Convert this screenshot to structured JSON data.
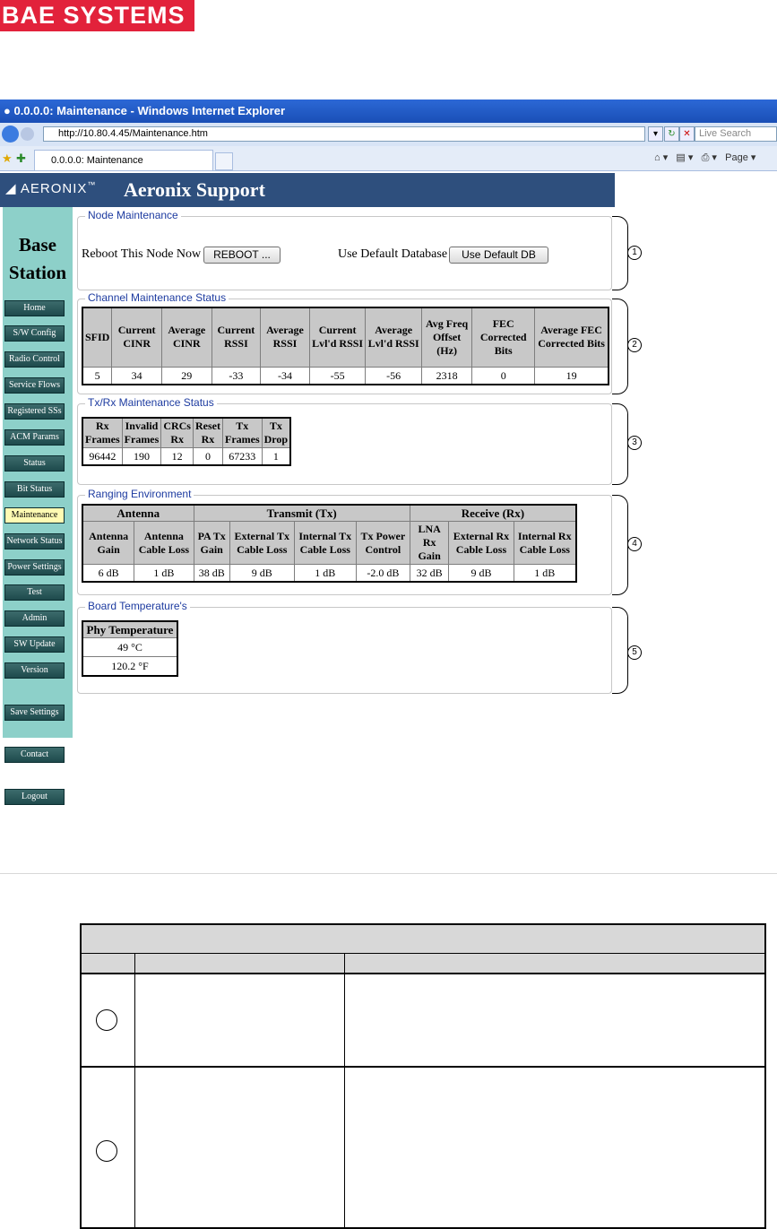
{
  "logo": {
    "text": "BAE SYSTEMS"
  },
  "browser": {
    "window_title": "0.0.0.0: Maintenance - Windows Internet Explorer",
    "url": "http://10.80.4.45/Maintenance.htm",
    "search_placeholder": "Live Search",
    "tab_title": "0.0.0.0: Maintenance",
    "page_menu": "Page"
  },
  "app": {
    "brand": "AERONIX",
    "title": "Aeronix Support"
  },
  "sidebar": {
    "title_line1": "Base",
    "title_line2": "Station",
    "items": [
      {
        "label": "Home"
      },
      {
        "label": "S/W Config"
      },
      {
        "label": "Radio Control"
      },
      {
        "label": "Service Flows"
      },
      {
        "label": "Registered SSs"
      },
      {
        "label": "ACM Params"
      },
      {
        "label": "Status"
      },
      {
        "label": "Bit Status"
      },
      {
        "label": "Maintenance"
      },
      {
        "label": "Network Status"
      },
      {
        "label": "Power Settings"
      },
      {
        "label": "Test"
      },
      {
        "label": "Admin"
      },
      {
        "label": "SW Update"
      },
      {
        "label": "Version"
      },
      {
        "label": "Save Settings"
      },
      {
        "label": "Contact"
      },
      {
        "label": "Logout"
      }
    ]
  },
  "node_maintenance": {
    "legend": "Node Maintenance",
    "reboot_label": "Reboot This Node Now",
    "reboot_button": "REBOOT ...",
    "default_db_label": "Use Default Database",
    "default_db_button": "Use Default DB",
    "callout": "1"
  },
  "channel": {
    "legend": "Channel Maintenance Status",
    "callout": "2",
    "headers": [
      "SFID",
      "Current CINR",
      "Average CINR",
      "Current RSSI",
      "Average RSSI",
      "Current Lvl'd RSSI",
      "Average Lvl'd RSSI",
      "Avg Freq Offset (Hz)",
      "FEC Corrected Bits",
      "Average FEC Corrected Bits"
    ],
    "values": [
      "5",
      "34",
      "29",
      "-33",
      "-34",
      "-55",
      "-56",
      "2318",
      "0",
      "19"
    ]
  },
  "txrx": {
    "legend": "Tx/Rx Maintenance Status",
    "callout": "3",
    "headers": [
      "Rx Frames",
      "Invalid Frames",
      "CRCs Rx",
      "Reset Rx",
      "Tx Frames",
      "Tx Drop"
    ],
    "values": [
      "96442",
      "190",
      "12",
      "0",
      "67233",
      "1"
    ]
  },
  "ranging": {
    "legend": "Ranging Environment",
    "callout": "4",
    "groups": [
      "Antenna",
      "Transmit (Tx)",
      "Receive (Rx)"
    ],
    "headers": [
      "Antenna Gain",
      "Antenna Cable Loss",
      "PA Tx Gain",
      "External Tx Cable Loss",
      "Internal Tx Cable Loss",
      "Tx Power Control",
      "LNA Rx Gain",
      "External Rx Cable Loss",
      "Internal Rx Cable Loss"
    ],
    "values": [
      "6 dB",
      "1 dB",
      "38 dB",
      "9 dB",
      "1 dB",
      "-2.0 dB",
      "32 dB",
      "9 dB",
      "1 dB"
    ]
  },
  "board_temp": {
    "legend": "Board Temperature's",
    "callout": "5",
    "header": "Phy Temperature",
    "celsius": "49 °C",
    "fahrenheit": "120.2 °F"
  }
}
